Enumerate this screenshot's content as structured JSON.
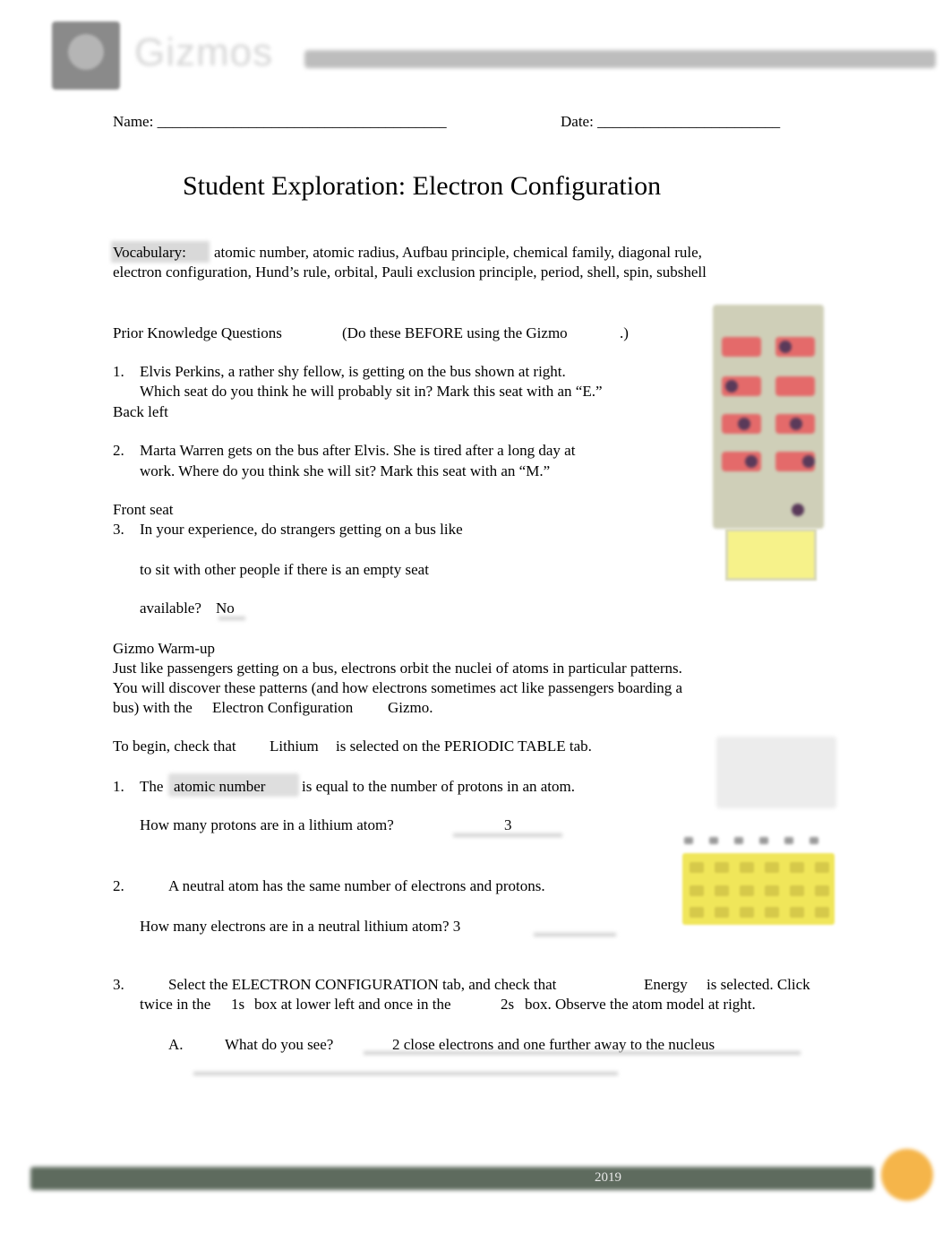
{
  "header": {
    "logo_text": "Gizmos",
    "name_label": "Name:",
    "name_blank": "______________________________________",
    "date_label": "Date:",
    "date_blank": "________________________"
  },
  "title": "Student Exploration: Electron Configuration",
  "vocabulary": {
    "label": "Vocabulary:",
    "line1": "atomic number, atomic radius, Aufbau principle, chemical family, diagonal rule,",
    "line2": "electron configuration, Hund’s rule, orbital, Pauli exclusion principle, period, shell, spin, subshell"
  },
  "prior_knowledge": {
    "heading": "Prior Knowledge Questions",
    "note_open": "(Do these BEFORE using the Gizmo",
    "note_close": ".)",
    "questions": [
      {
        "num": "1.",
        "line1": "Elvis Perkins, a rather shy fellow, is getting on the bus shown at right.",
        "line2": "Which seat do you think he will probably sit in? Mark this seat with an “E.”",
        "answer": "Back left"
      },
      {
        "num": "2.",
        "line1": "Marta Warren gets on the bus after Elvis. She is tired after a long day at",
        "line2": "work. Where do you think she will sit? Mark this seat with an “M.”",
        "answer": "Front seat"
      },
      {
        "num": "3.",
        "line1": "In your experience, do strangers getting on a bus like",
        "line2": "to sit with other people if there is an empty seat",
        "line3": "available?",
        "answer": "No"
      }
    ]
  },
  "warmup": {
    "heading": "Gizmo Warm-up",
    "para_line1": "Just like passengers getting on a bus, electrons orbit the nuclei of atoms in particular patterns.",
    "para_line2": "You will discover these patterns (and how electrons sometimes act like passengers boarding a",
    "para_line3_a": "bus) with the",
    "para_line3_b": "Electron Configuration",
    "para_line3_c": "Gizmo.",
    "begin_a": "To begin, check that",
    "begin_b": "Lithium",
    "begin_c": "is selected on the PERIODIC TABLE tab.",
    "q1": {
      "num": "1.",
      "a": "The",
      "term": "atomic number",
      "b": "is equal to the number of protons in an atom.",
      "sub": "How many protons are in a lithium atom?",
      "answer": "3"
    },
    "q2": {
      "num": "2.",
      "line": "A neutral atom has the same number of electrons and protons.",
      "sub": "How many electrons are in a neutral lithium atom? 3"
    },
    "q3": {
      "num": "3.",
      "a": "Select the ELECTRON CONFIGURATION tab, and check that",
      "b": "Energy",
      "c": "is selected. Click",
      "d": "twice in the",
      "e": "1s",
      "f": "box at lower left and once in the",
      "g": "2s",
      "h": "box. Observe the atom model at right.",
      "partA": {
        "label": "A.",
        "question": "What do you see?",
        "answer": "2 close electrons and one further away to the nucleus"
      }
    }
  },
  "footer": {
    "year": "2019"
  }
}
